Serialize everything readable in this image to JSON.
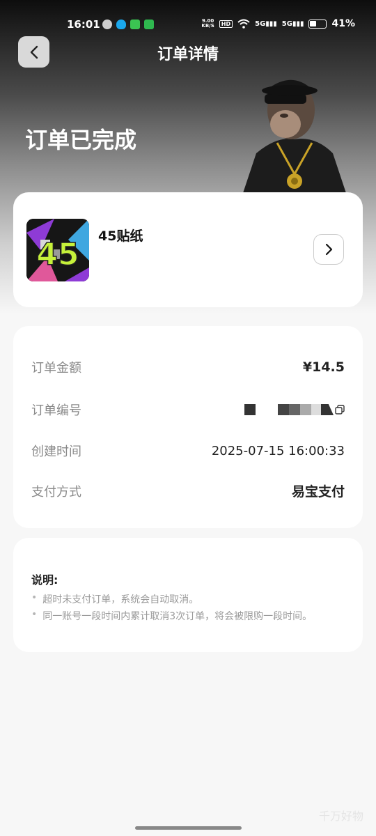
{
  "status_bar": {
    "time": "16:01",
    "net_speed_value": "9.00",
    "net_speed_unit": "KB/S",
    "hd_label": "HD",
    "signal1": "5G",
    "signal2": "5G",
    "battery_text": "41%",
    "battery_level": 0.41,
    "app_icons": [
      "wechat-icon",
      "qq-icon",
      "messages-icon",
      "phone-icon"
    ]
  },
  "header": {
    "title": "订单详情",
    "back_icon": "chevron-left-icon"
  },
  "order_status": "订单已完成",
  "product": {
    "name": "45贴纸",
    "thumbnail_text": "45",
    "arrow_icon": "chevron-right-icon"
  },
  "order_info": {
    "amount_label": "订单金额",
    "amount_value": "¥14.5",
    "number_label": "订单编号",
    "created_label": "创建时间",
    "created_value": "2025-07-15 16:00:33",
    "payment_label": "支付方式",
    "payment_value": "易宝支付",
    "copy_icon": "copy-icon"
  },
  "notes": {
    "title": "说明:",
    "items": [
      "超时未支付订单，系统会自动取消。",
      "同一账号一段时间内累计取消3次订单，将会被限购一段时间。"
    ]
  },
  "watermark": "千万好物"
}
